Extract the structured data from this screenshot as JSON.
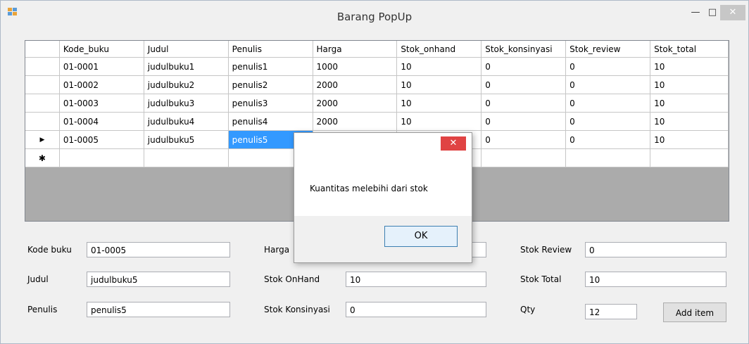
{
  "window": {
    "title": "Barang PopUp"
  },
  "grid": {
    "columns": [
      "Kode_buku",
      "Judul",
      "Penulis",
      "Harga",
      "Stok_onhand",
      "Stok_konsinyasi",
      "Stok_review",
      "Stok_total"
    ],
    "rows": [
      [
        "01-0001",
        "judulbuku1",
        "penulis1",
        "1000",
        "10",
        "0",
        "0",
        "10"
      ],
      [
        "01-0002",
        "judulbuku2",
        "penulis2",
        "2000",
        "10",
        "0",
        "0",
        "10"
      ],
      [
        "01-0003",
        "judulbuku3",
        "penulis3",
        "2000",
        "10",
        "0",
        "0",
        "10"
      ],
      [
        "01-0004",
        "judulbuku4",
        "penulis4",
        "2000",
        "10",
        "0",
        "0",
        "10"
      ],
      [
        "01-0005",
        "judulbuku5",
        "penulis5",
        "",
        "",
        "0",
        "0",
        "10"
      ]
    ],
    "current_row_marker": "▶",
    "new_row_marker": "✱"
  },
  "dialog": {
    "message": "Kuantitas melebihi dari stok",
    "ok_label": "OK",
    "close_glyph": "✕"
  },
  "form": {
    "kode_buku_label": "Kode buku",
    "kode_buku_value": "01-0005",
    "judul_label": "Judul",
    "judul_value": "judulbuku5",
    "penulis_label": "Penulis",
    "penulis_value": "penulis5",
    "harga_label": "Harga",
    "harga_value": "",
    "stok_onhand_label": "Stok OnHand",
    "stok_onhand_value": "10",
    "stok_konsinyasi_label": "Stok Konsinyasi",
    "stok_konsinyasi_value": "0",
    "stok_review_label": "Stok Review",
    "stok_review_value": "0",
    "stok_total_label": "Stok Total",
    "stok_total_value": "10",
    "qty_label": "Qty",
    "qty_value": "12",
    "add_item_label": "Add item"
  },
  "colors": {
    "selection": "#3399ff",
    "close_red": "#e04343",
    "grid_bg": "#ababab"
  }
}
